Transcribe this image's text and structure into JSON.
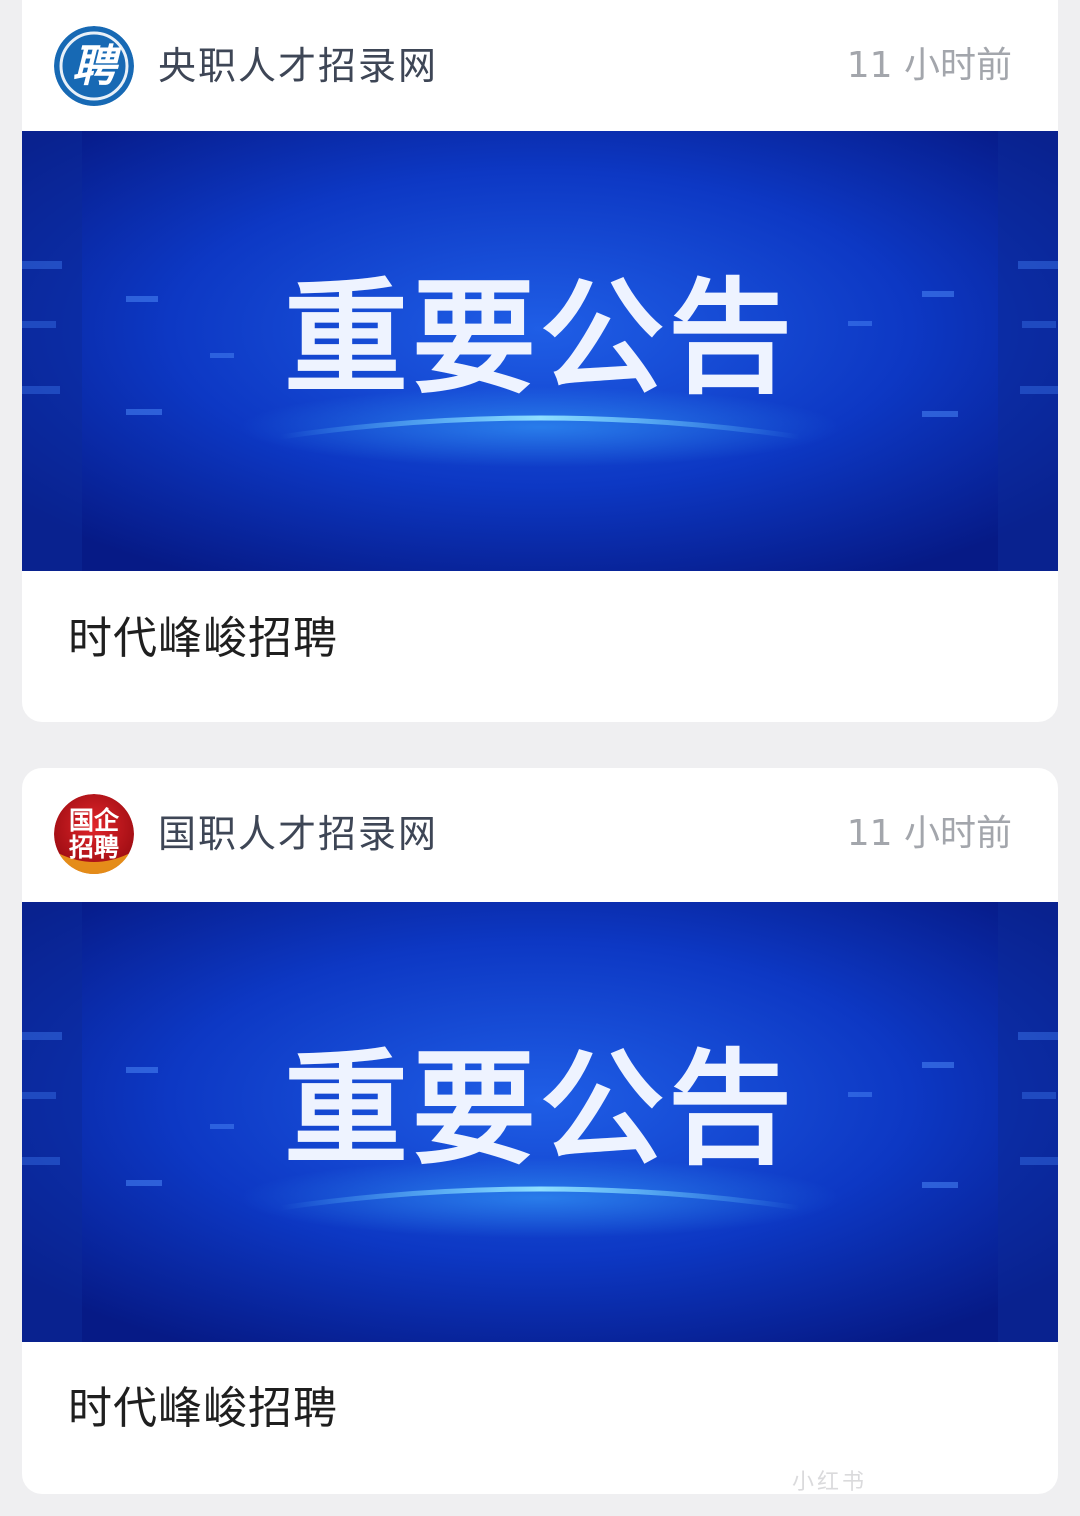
{
  "feed": {
    "posts": [
      {
        "account": {
          "name": "央职人才招录网",
          "avatar_text": "聘",
          "avatar_icon": "recruit-badge-icon",
          "avatar_color": "#1769b4"
        },
        "time": "11 小时前",
        "banner": {
          "text": "重要公告",
          "bg_color": "#0a2fb4"
        },
        "title": "时代峰峻招聘"
      },
      {
        "account": {
          "name": "国职人才招录网",
          "avatar_text_line1": "国企",
          "avatar_text_line2": "招聘",
          "avatar_icon": "soe-recruit-badge-icon",
          "avatar_color": "#c1121a"
        },
        "time": "11 小时前",
        "banner": {
          "text": "重要公告",
          "bg_color": "#0a2fb4"
        },
        "title": "时代峰峻招聘"
      }
    ]
  },
  "watermark": "小红书"
}
